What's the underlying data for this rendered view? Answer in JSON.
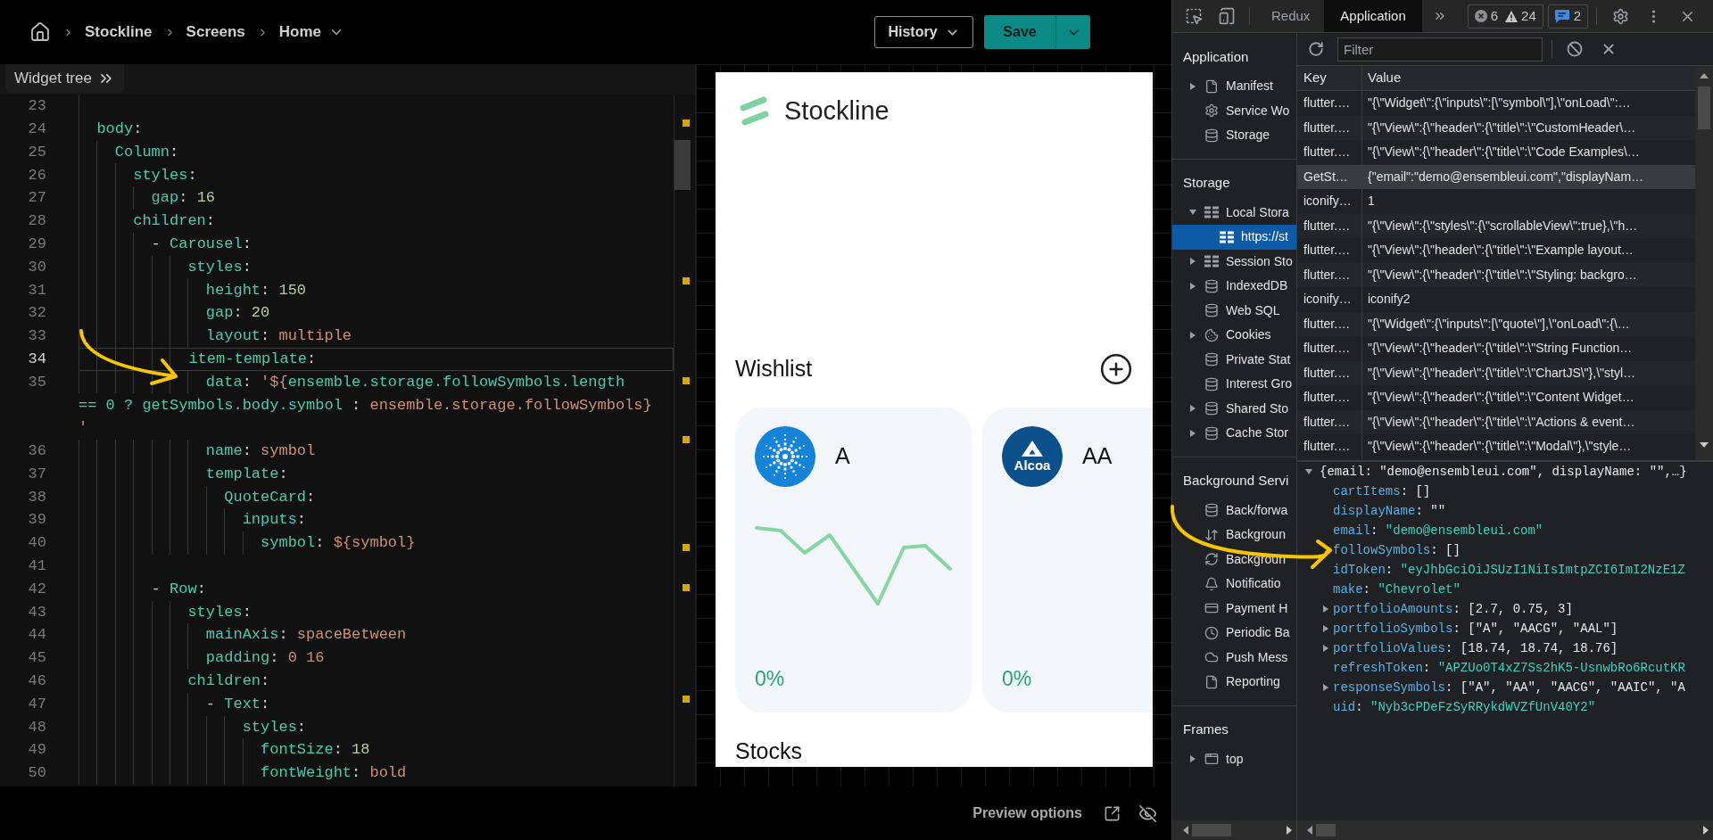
{
  "topbar": {
    "breadcrumbs": [
      {
        "label": "Stockline",
        "dropdown": false
      },
      {
        "label": "Screens",
        "dropdown": false
      },
      {
        "label": "Home",
        "dropdown": true
      }
    ],
    "history_button": "History",
    "save_button": "Save"
  },
  "editor": {
    "panel_toggle": "Widget tree",
    "lines": [
      {
        "number": "23",
        "current": false
      },
      {
        "number": "24",
        "current": false,
        "tokens": [
          {
            "kind": "key",
            "text": "  body"
          },
          {
            "kind": "punct",
            "text": ":"
          }
        ]
      },
      {
        "number": "25",
        "current": false,
        "tokens": [
          {
            "kind": "key",
            "text": "    Column"
          },
          {
            "kind": "punct",
            "text": ":"
          }
        ]
      },
      {
        "number": "26",
        "current": false,
        "tokens": [
          {
            "kind": "key",
            "text": "      styles"
          },
          {
            "kind": "punct",
            "text": ":"
          }
        ]
      },
      {
        "number": "27",
        "current": false,
        "tokens": [
          {
            "kind": "key",
            "text": "        gap"
          },
          {
            "kind": "punct",
            "text": ": "
          },
          {
            "kind": "number",
            "text": "16"
          }
        ]
      },
      {
        "number": "28",
        "current": false,
        "tokens": [
          {
            "kind": "key",
            "text": "      children"
          },
          {
            "kind": "punct",
            "text": ":"
          }
        ]
      },
      {
        "number": "29",
        "current": false,
        "tokens": [
          {
            "kind": "punct",
            "text": "        - "
          },
          {
            "kind": "key",
            "text": "Carousel"
          },
          {
            "kind": "punct",
            "text": ":"
          }
        ]
      },
      {
        "number": "30",
        "current": false,
        "tokens": [
          {
            "kind": "key",
            "text": "            styles"
          },
          {
            "kind": "punct",
            "text": ":"
          }
        ]
      },
      {
        "number": "31",
        "current": false,
        "tokens": [
          {
            "kind": "key",
            "text": "              height"
          },
          {
            "kind": "punct",
            "text": ": "
          },
          {
            "kind": "number",
            "text": "150"
          }
        ]
      },
      {
        "number": "32",
        "current": false,
        "tokens": [
          {
            "kind": "key",
            "text": "              gap"
          },
          {
            "kind": "punct",
            "text": ": "
          },
          {
            "kind": "number",
            "text": "20"
          }
        ]
      },
      {
        "number": "33",
        "current": false,
        "tokens": [
          {
            "kind": "key",
            "text": "              layout"
          },
          {
            "kind": "punct",
            "text": ": "
          },
          {
            "kind": "string",
            "text": "multiple"
          }
        ]
      },
      {
        "number": "34",
        "current": true,
        "tokens": [
          {
            "kind": "key",
            "text": "            item-template"
          },
          {
            "kind": "punct",
            "text": ":"
          }
        ]
      },
      {
        "number": "35",
        "current": false,
        "tokens": [
          {
            "kind": "key",
            "text": "              data"
          },
          {
            "kind": "punct",
            "text": ": "
          },
          {
            "kind": "string",
            "text": "'${"
          },
          {
            "kind": "key",
            "text": "ensemble.storage.followSymbols.length"
          }
        ],
        "wraps": [
          [
            {
              "kind": "key",
              "text": "== 0 ? getSymbols.body.symbol"
            },
            {
              "kind": "punct",
              "text": " : "
            },
            {
              "kind": "string",
              "text": "ensemble.storage.followSymbols}"
            }
          ],
          [
            {
              "kind": "string",
              "text": "'"
            }
          ]
        ]
      },
      {
        "number": "36",
        "current": false,
        "tokens": [
          {
            "kind": "key",
            "text": "              name"
          },
          {
            "kind": "punct",
            "text": ": "
          },
          {
            "kind": "string",
            "text": "symbol"
          }
        ]
      },
      {
        "number": "37",
        "current": false,
        "tokens": [
          {
            "kind": "key",
            "text": "              template"
          },
          {
            "kind": "punct",
            "text": ":"
          }
        ]
      },
      {
        "number": "38",
        "current": false,
        "tokens": [
          {
            "kind": "key",
            "text": "                QuoteCard"
          },
          {
            "kind": "punct",
            "text": ":"
          }
        ]
      },
      {
        "number": "39",
        "current": false,
        "tokens": [
          {
            "kind": "key",
            "text": "                  inputs"
          },
          {
            "kind": "punct",
            "text": ":"
          }
        ]
      },
      {
        "number": "40",
        "current": false,
        "tokens": [
          {
            "kind": "key",
            "text": "                    symbol"
          },
          {
            "kind": "punct",
            "text": ": "
          },
          {
            "kind": "string",
            "text": "${symbol}"
          }
        ]
      },
      {
        "number": "41",
        "current": false
      },
      {
        "number": "42",
        "current": false,
        "tokens": [
          {
            "kind": "punct",
            "text": "        - "
          },
          {
            "kind": "key",
            "text": "Row"
          },
          {
            "kind": "punct",
            "text": ":"
          }
        ]
      },
      {
        "number": "43",
        "current": false,
        "tokens": [
          {
            "kind": "key",
            "text": "            styles"
          },
          {
            "kind": "punct",
            "text": ":"
          }
        ]
      },
      {
        "number": "44",
        "current": false,
        "tokens": [
          {
            "kind": "key",
            "text": "              mainAxis"
          },
          {
            "kind": "punct",
            "text": ": "
          },
          {
            "kind": "string",
            "text": "spaceBetween"
          }
        ]
      },
      {
        "number": "45",
        "current": false,
        "tokens": [
          {
            "kind": "key",
            "text": "              padding"
          },
          {
            "kind": "punct",
            "text": ": "
          },
          {
            "kind": "string",
            "text": "0 16"
          }
        ]
      },
      {
        "number": "46",
        "current": false,
        "tokens": [
          {
            "kind": "key",
            "text": "            children"
          },
          {
            "kind": "punct",
            "text": ":"
          }
        ]
      },
      {
        "number": "47",
        "current": false,
        "tokens": [
          {
            "kind": "punct",
            "text": "              - "
          },
          {
            "kind": "key",
            "text": "Text"
          },
          {
            "kind": "punct",
            "text": ":"
          }
        ]
      },
      {
        "number": "48",
        "current": false,
        "tokens": [
          {
            "kind": "key",
            "text": "                  styles"
          },
          {
            "kind": "punct",
            "text": ":"
          }
        ]
      },
      {
        "number": "49",
        "current": false,
        "tokens": [
          {
            "kind": "key",
            "text": "                    fontSize"
          },
          {
            "kind": "punct",
            "text": ": "
          },
          {
            "kind": "number",
            "text": "18"
          }
        ]
      },
      {
        "number": "50",
        "current": false,
        "tokens": [
          {
            "kind": "key",
            "text": "                    fontWeight"
          },
          {
            "kind": "punct",
            "text": ": "
          },
          {
            "kind": "string",
            "text": "bold"
          }
        ]
      }
    ]
  },
  "preview": {
    "title": "Stockline",
    "wishlist": {
      "title": "Wishlist",
      "cards": [
        {
          "kind": "starburst",
          "symbol": "A",
          "sparkline": true,
          "change": "0%"
        },
        {
          "kind": "triangle",
          "logo_text": "Alcoa",
          "symbol": "AA",
          "sparkline": false,
          "change": "0%"
        }
      ]
    },
    "stocks_title": "Stocks",
    "options_label": "Preview options"
  },
  "devtools": {
    "tabs": [
      {
        "label": "Redux",
        "selected": false
      },
      {
        "label": "Application",
        "selected": true
      }
    ],
    "issues": {
      "errors": "6",
      "warnings": "24",
      "messages": "2"
    },
    "sidebar": [
      {
        "title": "Application",
        "items": [
          {
            "label": "Manifest",
            "kind": "file",
            "expanded": false,
            "selected": false
          },
          {
            "label": "Service Wo",
            "kind": "gear",
            "selected": false
          },
          {
            "label": "Storage",
            "kind": "database",
            "selected": false
          }
        ]
      },
      {
        "title": "Storage",
        "items": [
          {
            "label": "Local Stora",
            "kind": "grid",
            "expanded": true,
            "selected": false,
            "children": [
              {
                "label": "https://st",
                "kind": "grid",
                "selected": true
              }
            ]
          },
          {
            "label": "Session Sto",
            "kind": "grid",
            "expanded": false,
            "selected": false
          },
          {
            "label": "IndexedDB",
            "kind": "database",
            "expanded": false,
            "selected": false
          },
          {
            "label": "Web SQL",
            "kind": "database",
            "selected": false
          },
          {
            "label": "Cookies",
            "kind": "cookie",
            "expanded": false,
            "selected": false
          },
          {
            "label": "Private Stat",
            "kind": "database",
            "selected": false
          },
          {
            "label": "Interest Gro",
            "kind": "database",
            "selected": false
          },
          {
            "label": "Shared Sto",
            "kind": "database",
            "expanded": false,
            "selected": false
          },
          {
            "label": "Cache Stor",
            "kind": "database",
            "expanded": false,
            "selected": false
          }
        ]
      },
      {
        "title": "Background Servi",
        "items": [
          {
            "label": "Back/forwa",
            "kind": "database",
            "selected": false
          },
          {
            "label": "Backgroun",
            "kind": "arrows",
            "selected": false
          },
          {
            "label": "Backgroun",
            "kind": "sync",
            "selected": false
          },
          {
            "label": "Notificatio",
            "kind": "bell",
            "selected": false
          },
          {
            "label": "Payment H",
            "kind": "card",
            "selected": false
          },
          {
            "label": "Periodic Ba",
            "kind": "clock",
            "selected": false
          },
          {
            "label": "Push Mess",
            "kind": "cloud",
            "selected": false
          },
          {
            "label": "Reporting",
            "kind": "file",
            "selected": false
          }
        ]
      },
      {
        "title": "Frames",
        "items": [
          {
            "label": "top",
            "kind": "frame",
            "expanded": false,
            "selected": false
          }
        ]
      }
    ],
    "filter": {
      "placeholder": "Filter"
    },
    "table": {
      "columns": [
        "Key",
        "Value"
      ],
      "rows": [
        {
          "key": "flutter.…",
          "value": "\"{\\\"Widget\\\":{\\\"inputs\\\":[\\\"symbol\\\"],\\\"onLoad\\\":…",
          "selected": false
        },
        {
          "key": "flutter.…",
          "value": "\"{\\\"View\\\":{\\\"header\\\":{\\\"title\\\":\\\"CustomHeader\\…",
          "selected": false
        },
        {
          "key": "flutter.…",
          "value": "\"{\\\"View\\\":{\\\"header\\\":{\\\"title\\\":\\\"Code Examples\\…",
          "selected": false
        },
        {
          "key": "GetSt…",
          "value": "{\"email\":\"demo@ensembleui.com\",\"displayNam…",
          "selected": true
        },
        {
          "key": "iconify…",
          "value": "1",
          "selected": false
        },
        {
          "key": "flutter.…",
          "value": "\"{\\\"View\\\":{\\\"styles\\\":{\\\"scrollableView\\\":true},\\\"h…",
          "selected": false
        },
        {
          "key": "flutter.…",
          "value": "\"{\\\"View\\\":{\\\"header\\\":{\\\"title\\\":\\\"Example layout…",
          "selected": false
        },
        {
          "key": "flutter.…",
          "value": "\"{\\\"View\\\":{\\\"header\\\":{\\\"title\\\":\\\"Styling: backgro…",
          "selected": false
        },
        {
          "key": "iconify…",
          "value": "iconify2",
          "selected": false
        },
        {
          "key": "flutter.…",
          "value": "\"{\\\"Widget\\\":{\\\"inputs\\\":[\\\"quote\\\"],\\\"onLoad\\\":{\\…",
          "selected": false
        },
        {
          "key": "flutter.…",
          "value": "\"{\\\"View\\\":{\\\"header\\\":{\\\"title\\\":\\\"String Function…",
          "selected": false
        },
        {
          "key": "flutter.…",
          "value": "\"{\\\"View\\\":{\\\"header\\\":{\\\"title\\\":\\\"ChartJS\\\"},\\\"styl…",
          "selected": false
        },
        {
          "key": "flutter.…",
          "value": "\"{\\\"View\\\":{\\\"header\\\":{\\\"title\\\":\\\"Content Widget…",
          "selected": false
        },
        {
          "key": "flutter.…",
          "value": "\"{\\\"View\\\":{\\\"header\\\":{\\\"title\\\":\\\"Actions & event…",
          "selected": false
        },
        {
          "key": "flutter.…",
          "value": "\"{\\\"View\\\":{\\\"header\\\":{\\\"title\\\":\\\"Modal\\\"},\\\"style…",
          "selected": false
        }
      ]
    },
    "object_view": {
      "summary": "{email: \"demo@ensembleui.com\", displayName: \"\",…}",
      "expanded": true,
      "properties": [
        {
          "key": "cartItems",
          "separator": ": ",
          "value": "[]",
          "kind": "literal"
        },
        {
          "key": "displayName",
          "separator": ": ",
          "value": "\"\"",
          "kind": "literal"
        },
        {
          "key": "email",
          "separator": ": ",
          "value": "\"demo@ensembleui.com\"",
          "kind": "string"
        },
        {
          "key": "followSymbols",
          "separator": ": ",
          "value": "[]",
          "kind": "literal"
        },
        {
          "key": "idToken",
          "separator": ": ",
          "value": "\"eyJhbGciOiJSUzI1NiIsImtpZCI6ImI2NzE1Z",
          "kind": "string"
        },
        {
          "key": "make",
          "separator": ": ",
          "value": "\"Chevrolet\"",
          "kind": "string"
        },
        {
          "key": "portfolioAmounts",
          "separator": ": ",
          "value": "[2.7, 0.75, 3]",
          "kind": "literal",
          "expanded": false
        },
        {
          "key": "portfolioSymbols",
          "separator": ": ",
          "value": "[\"A\", \"AACG\", \"AAL\"]",
          "kind": "literal",
          "expanded": false
        },
        {
          "key": "portfolioValues",
          "separator": ": ",
          "value": "[18.74, 18.74, 18.76]",
          "kind": "literal",
          "expanded": false
        },
        {
          "key": "refreshToken",
          "separator": ": ",
          "value": "\"APZUo0T4xZ7Ss2hK5-UsnwbRo6RcutKR",
          "kind": "string"
        },
        {
          "key": "responseSymbols",
          "separator": ": ",
          "value": "[\"A\", \"AA\", \"AACG\", \"AAIC\", \"A",
          "kind": "literal",
          "expanded": false
        },
        {
          "key": "uid",
          "separator": ": ",
          "value": "\"Nyb3cPDeFzSyRRykdWVZfUnV40Y2\"",
          "kind": "string"
        }
      ]
    }
  }
}
